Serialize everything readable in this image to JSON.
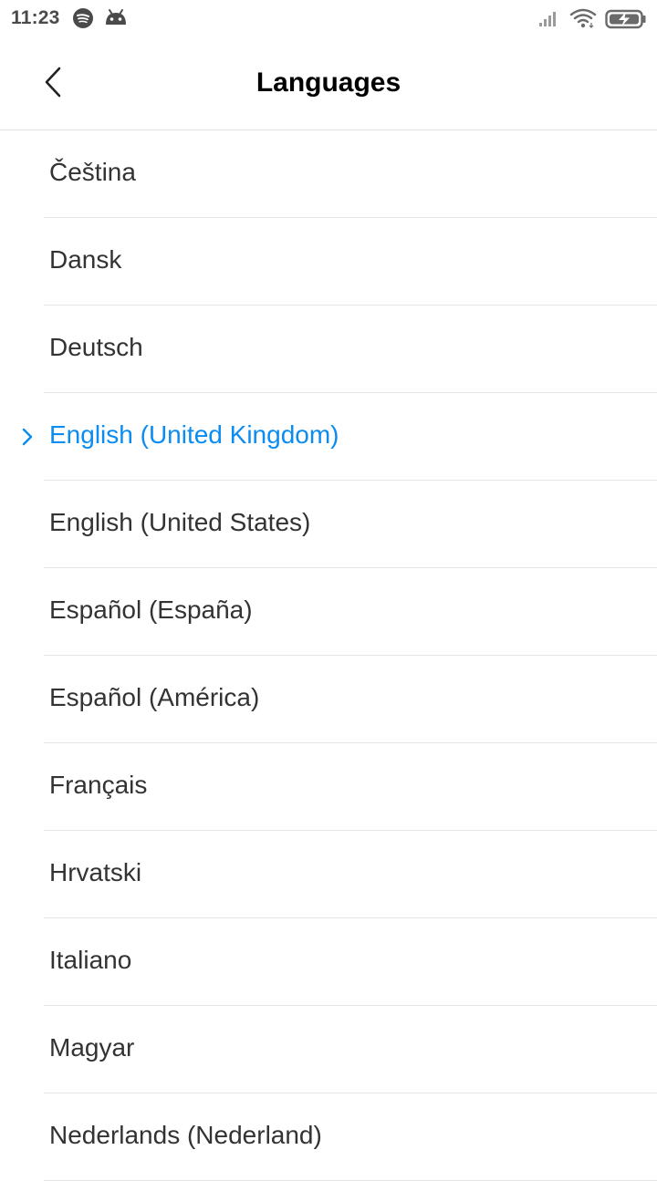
{
  "status_bar": {
    "time": "11:23",
    "notification_icons": [
      "spotify-icon",
      "android-icon"
    ],
    "system_icons": [
      "signal-icon",
      "wifi-icon",
      "battery-charging-icon"
    ]
  },
  "header": {
    "title": "Languages",
    "back_icon": "chevron-left-icon"
  },
  "colors": {
    "accent": "#0a8cf0",
    "text": "#333333",
    "divider": "#e4e4e4"
  },
  "languages": [
    {
      "label": "Čeština",
      "selected": false
    },
    {
      "label": "Dansk",
      "selected": false
    },
    {
      "label": "Deutsch",
      "selected": false
    },
    {
      "label": "English (United Kingdom)",
      "selected": true
    },
    {
      "label": "English (United States)",
      "selected": false
    },
    {
      "label": "Español (España)",
      "selected": false
    },
    {
      "label": "Español (América)",
      "selected": false
    },
    {
      "label": "Français",
      "selected": false
    },
    {
      "label": "Hrvatski",
      "selected": false
    },
    {
      "label": "Italiano",
      "selected": false
    },
    {
      "label": "Magyar",
      "selected": false
    },
    {
      "label": "Nederlands (Nederland)",
      "selected": false
    }
  ]
}
